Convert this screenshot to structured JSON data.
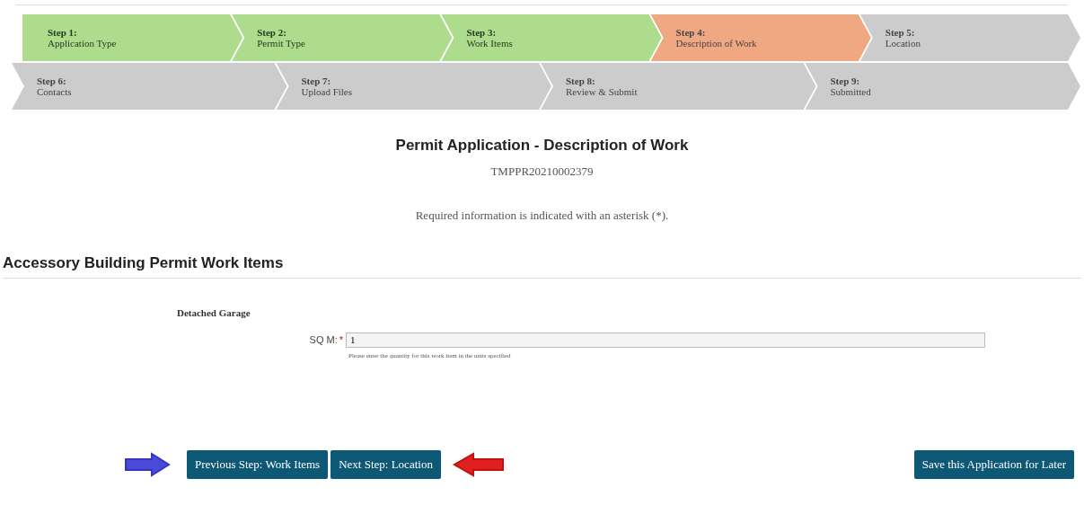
{
  "steps": [
    [
      {
        "label": "Step 1:",
        "name": "Application Type",
        "completed": true,
        "selected": false
      },
      {
        "label": "Step 2:",
        "name": "Permit Type",
        "completed": true,
        "selected": false
      },
      {
        "label": "Step 3:",
        "name": "Work Items",
        "completed": true,
        "selected": false
      },
      {
        "label": "Step 4:",
        "name": "Description of Work",
        "completed": false,
        "selected": true
      },
      {
        "label": "Step 5:",
        "name": "Location",
        "completed": false,
        "selected": false
      }
    ],
    [
      {
        "label": "Step 6:",
        "name": "Contacts",
        "completed": false,
        "selected": false
      },
      {
        "label": "Step 7:",
        "name": "Upload Files",
        "completed": false,
        "selected": false
      },
      {
        "label": "Step 8:",
        "name": "Review & Submit",
        "completed": false,
        "selected": false
      },
      {
        "label": "Step 9:",
        "name": "Submitted",
        "completed": false,
        "selected": false
      }
    ]
  ],
  "title": "Permit Application - Description of Work",
  "record_number": "TMPPR20210002379",
  "required_note": "Required information is indicated with an asterisk (*).",
  "section": {
    "title": "Accessory Building Permit Work Items",
    "item": {
      "name": "Detached Garage",
      "field_label": "SQ M:",
      "required_mark": "*",
      "value": "1",
      "help": "Please enter the quantity for this work item in the units specified"
    }
  },
  "buttons": {
    "previous": "Previous Step: Work Items",
    "next": "Next Step: Location",
    "save": "Save this Application for Later"
  }
}
